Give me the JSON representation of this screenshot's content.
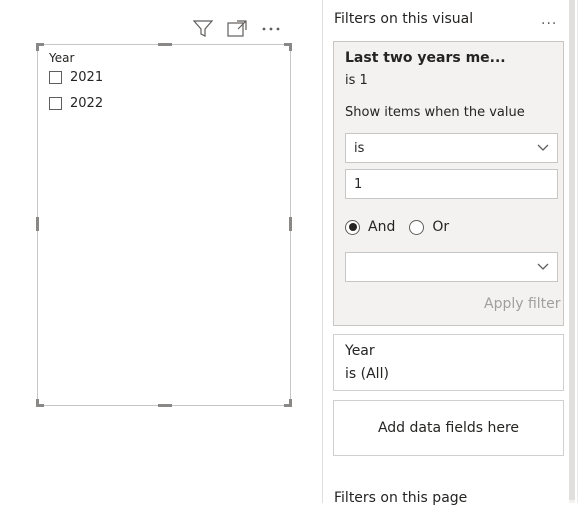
{
  "visual_header": {
    "icons": [
      "filter-icon",
      "focus-mode-icon",
      "more-options-icon"
    ]
  },
  "slicer": {
    "title": "Year",
    "items": [
      {
        "label": "2021",
        "checked": false
      },
      {
        "label": "2022",
        "checked": false
      }
    ]
  },
  "filters_pane": {
    "visual_section_title": "Filters on this visual",
    "more_label": "...",
    "active_filter": {
      "title": "Last two years me...",
      "summary": "is 1",
      "show_items_label": "Show items when the value",
      "condition1": "is",
      "value1": "1",
      "and_label": "And",
      "or_label": "Or",
      "selected_operator": "And",
      "condition2": "",
      "apply_label": "Apply filter"
    },
    "year_filter": {
      "title": "Year",
      "summary": "is (All)"
    },
    "add_fields_label": "Add data fields here",
    "page_section_title": "Filters on this page"
  },
  "colors": {
    "accent": "#252423",
    "disabled_text": "#a19f9d",
    "card_bg": "#f3f2f1",
    "border": "#c8c6c4"
  }
}
